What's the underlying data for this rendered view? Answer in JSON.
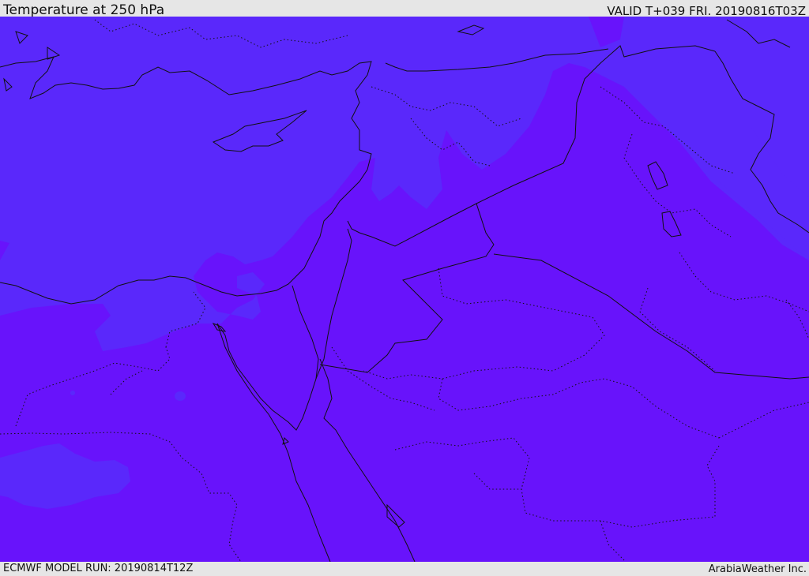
{
  "header": {
    "title": "Temperature at 250 hPa",
    "valid_time": "VALID T+039 FRI. 20190816T03Z"
  },
  "footer": {
    "model_run": "ECMWF MODEL RUN: 20190814T12Z",
    "credit": "ArabiaWeather Inc."
  },
  "colors": {
    "cold_band": "#5a28fb",
    "warm_band": "#6813fb",
    "border_line": "#111111"
  }
}
